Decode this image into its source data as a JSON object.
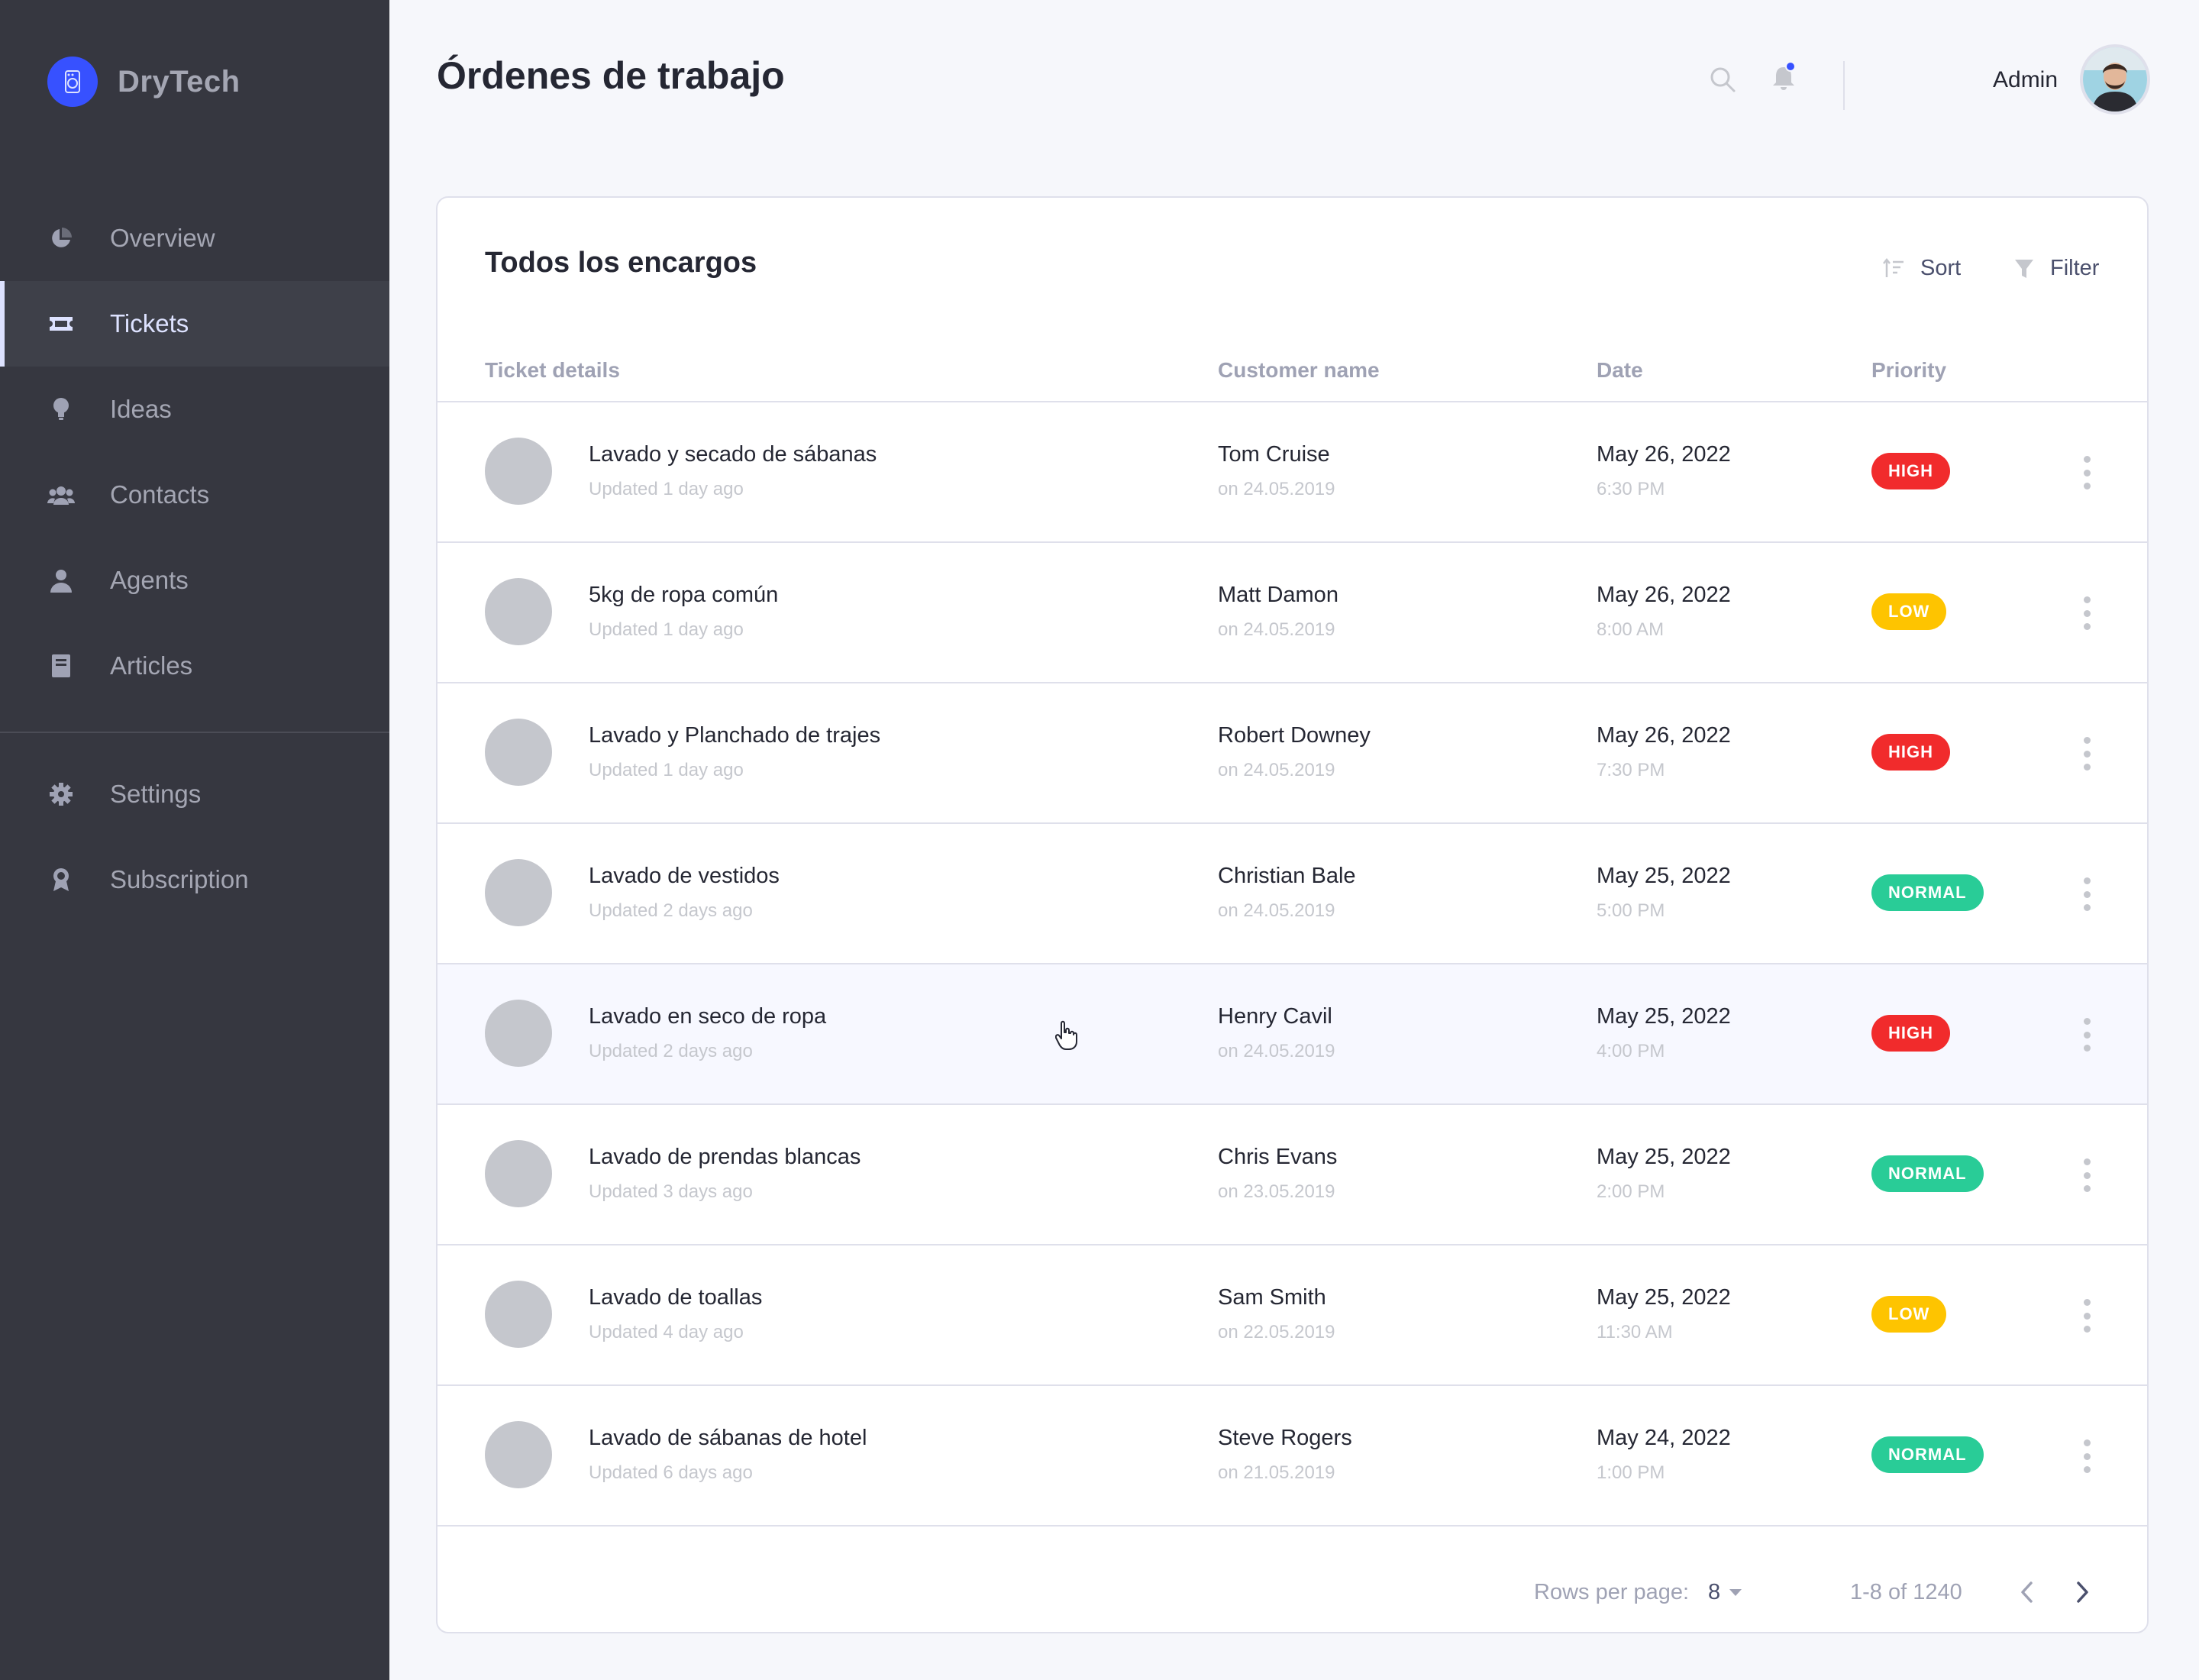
{
  "app": {
    "brand": "DryTech"
  },
  "sidebar": {
    "items": [
      {
        "label": "Overview",
        "icon": "pie-chart-icon"
      },
      {
        "label": "Tickets",
        "icon": "ticket-icon",
        "active": true
      },
      {
        "label": "Ideas",
        "icon": "lightbulb-icon"
      },
      {
        "label": "Contacts",
        "icon": "contacts-icon"
      },
      {
        "label": "Agents",
        "icon": "agent-icon"
      },
      {
        "label": "Articles",
        "icon": "book-icon"
      }
    ],
    "secondary": [
      {
        "label": "Settings",
        "icon": "gear-icon"
      },
      {
        "label": "Subscription",
        "icon": "award-icon"
      }
    ]
  },
  "header": {
    "title": "Órdenes de trabajo",
    "user_name": "Admin"
  },
  "card": {
    "title": "Todos los encargos",
    "sort_label": "Sort",
    "filter_label": "Filter",
    "columns": [
      "Ticket details",
      "Customer name",
      "Date",
      "Priority"
    ],
    "rows": [
      {
        "title": "Lavado y secado de sábanas",
        "updated": "Updated 1 day ago",
        "customer": "Tom Cruise",
        "customer_date": "on 24.05.2019",
        "date": "May 26, 2022",
        "time": "6:30 PM",
        "priority": "HIGH"
      },
      {
        "title": "5kg de ropa común",
        "updated": "Updated 1 day ago",
        "customer": "Matt Damon",
        "customer_date": "on 24.05.2019",
        "date": "May 26, 2022",
        "time": "8:00 AM",
        "priority": "LOW"
      },
      {
        "title": "Lavado y Planchado de trajes",
        "updated": "Updated 1 day ago",
        "customer": "Robert Downey",
        "customer_date": "on 24.05.2019",
        "date": "May 26, 2022",
        "time": "7:30 PM",
        "priority": "HIGH"
      },
      {
        "title": "Lavado de vestidos",
        "updated": "Updated 2 days ago",
        "customer": "Christian Bale",
        "customer_date": "on 24.05.2019",
        "date": "May 25, 2022",
        "time": "5:00 PM",
        "priority": "NORMAL"
      },
      {
        "title": "Lavado en seco de ropa",
        "updated": "Updated 2 days ago",
        "customer": "Henry Cavil",
        "customer_date": "on 24.05.2019",
        "date": "May 25, 2022",
        "time": "4:00 PM",
        "priority": "HIGH"
      },
      {
        "title": "Lavado de prendas blancas",
        "updated": "Updated 3 days ago",
        "customer": "Chris Evans",
        "customer_date": "on 23.05.2019",
        "date": "May 25, 2022",
        "time": "2:00 PM",
        "priority": "NORMAL"
      },
      {
        "title": "Lavado de toallas",
        "updated": "Updated 4 day ago",
        "customer": "Sam Smith",
        "customer_date": "on 22.05.2019",
        "date": "May 25, 2022",
        "time": "11:30 AM",
        "priority": "LOW"
      },
      {
        "title": "Lavado de sábanas de hotel",
        "updated": "Updated 6 days ago",
        "customer": "Steve Rogers",
        "customer_date": "on 21.05.2019",
        "date": "May 24, 2022",
        "time": "1:00 PM",
        "priority": "NORMAL"
      }
    ]
  },
  "pagination": {
    "rows_label": "Rows per page:",
    "rows_value": "8",
    "range": "1-8 of 1240"
  },
  "colors": {
    "sidebar_bg": "#363740",
    "accent": "#3751ff",
    "high": "#f12b2c",
    "low": "#fec400",
    "normal": "#29cc97"
  }
}
